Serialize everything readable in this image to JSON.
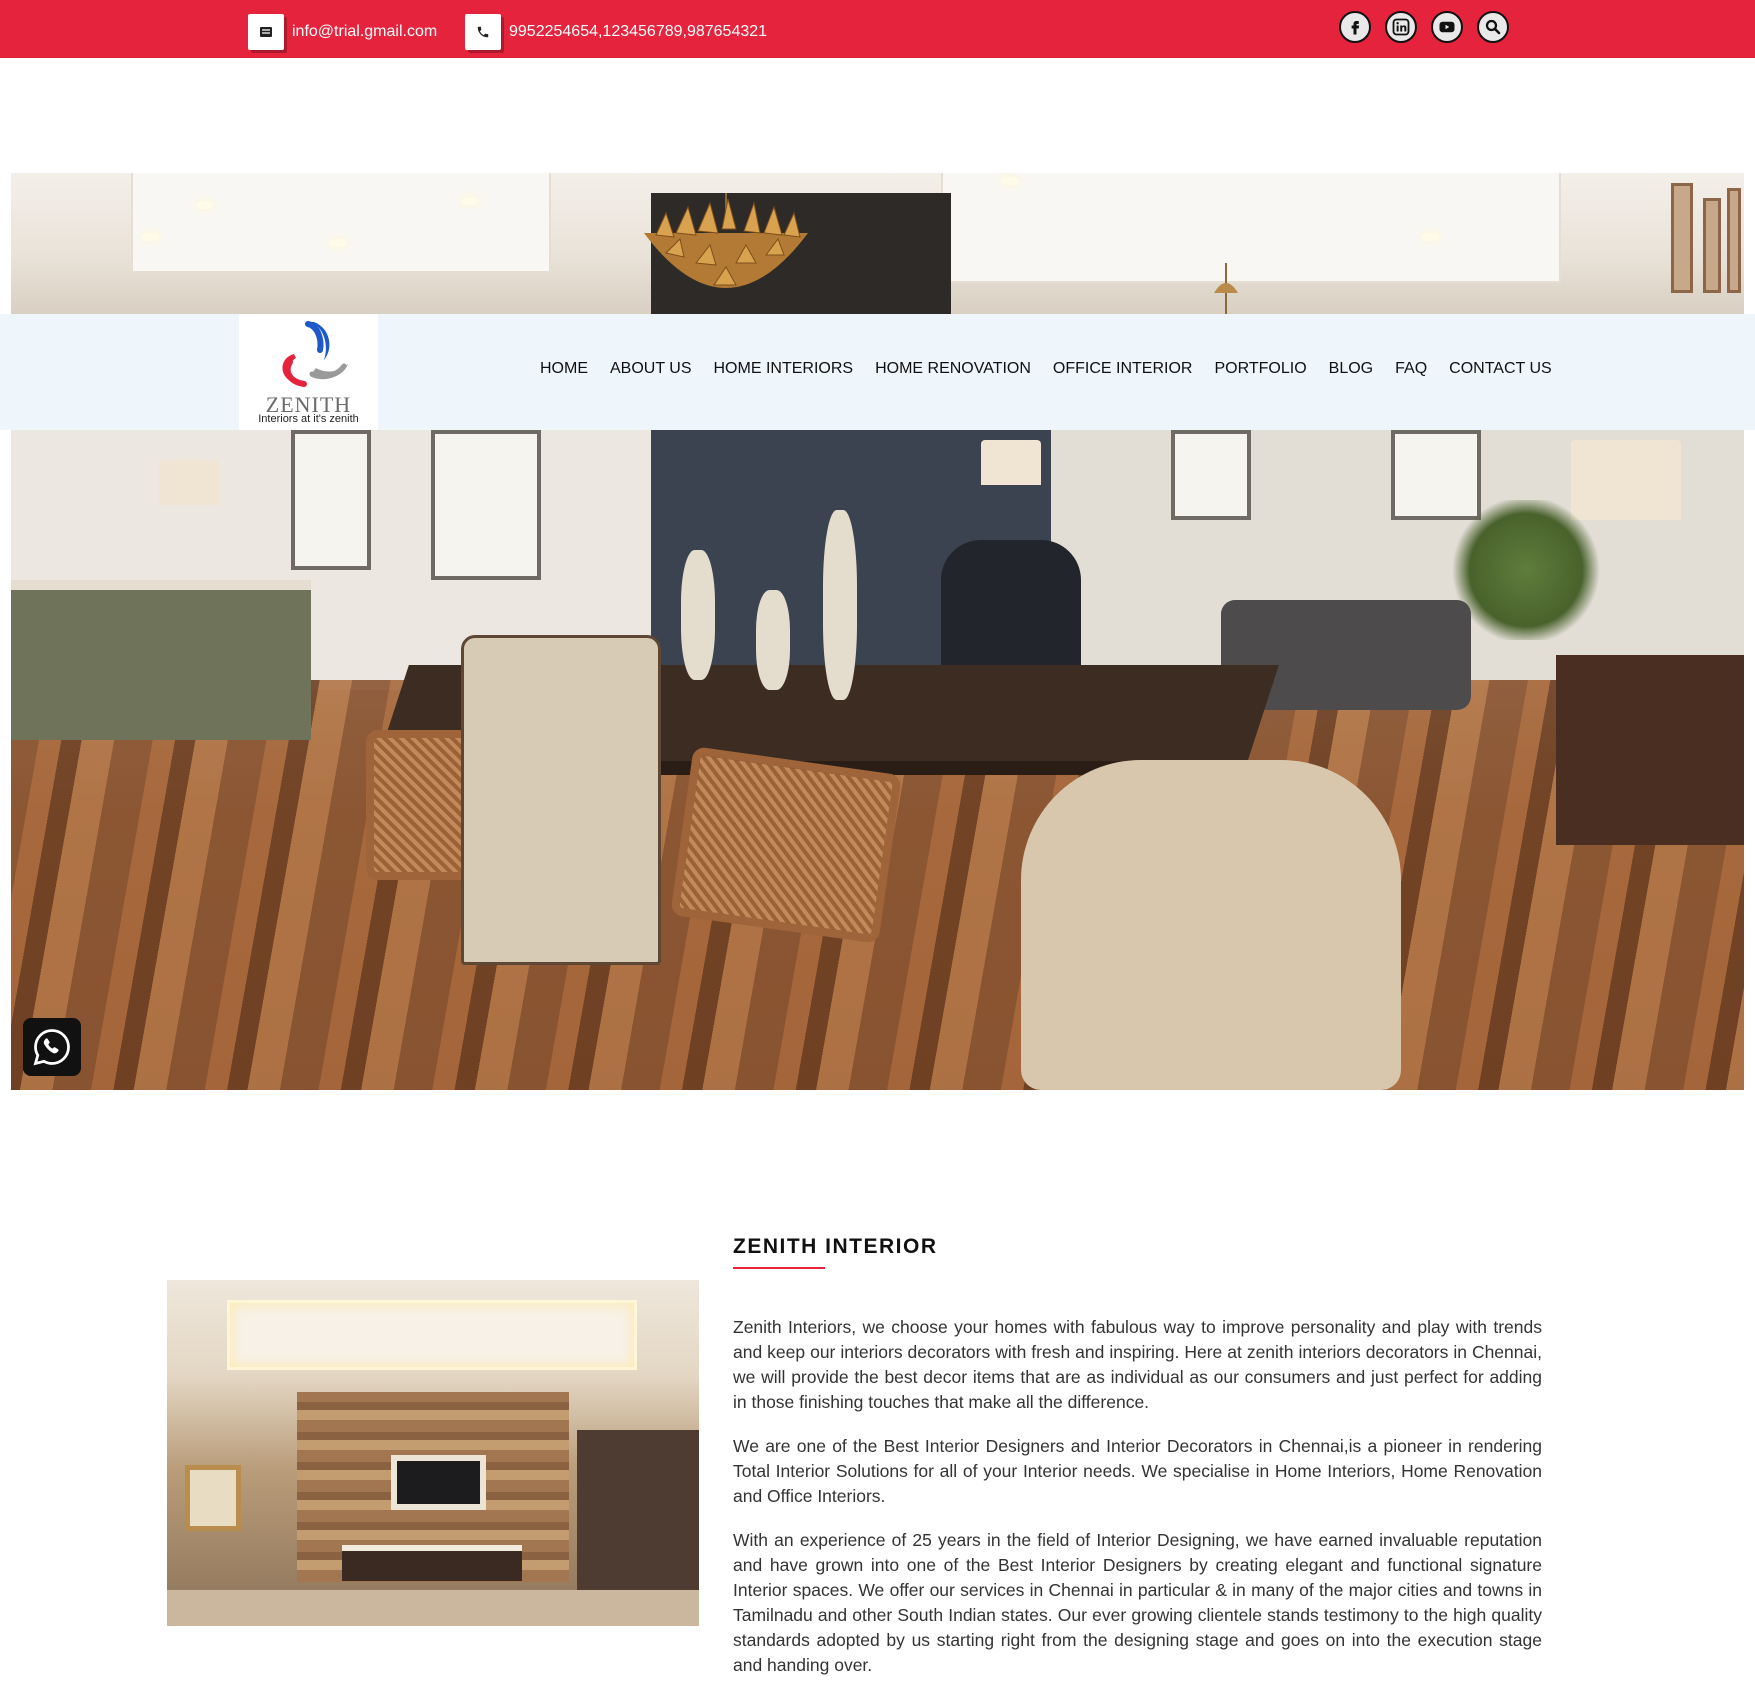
{
  "topbar": {
    "email": "info@trial.gmail.com",
    "phone": "9952254654,123456789,987654321",
    "background": "#e5233c",
    "socials": [
      {
        "name": "facebook-icon"
      },
      {
        "name": "linkedin-icon"
      },
      {
        "name": "youtube-icon"
      },
      {
        "name": "search-icon"
      }
    ]
  },
  "logo": {
    "name": "ZENITH",
    "tagline": "Interiors at it's zenith"
  },
  "nav": {
    "items": [
      {
        "label": "HOME"
      },
      {
        "label": "ABOUT US"
      },
      {
        "label": "HOME INTERIORS"
      },
      {
        "label": "HOME RENOVATION"
      },
      {
        "label": "OFFICE INTERIOR"
      },
      {
        "label": "PORTFOLIO"
      },
      {
        "label": "BLOG"
      },
      {
        "label": "FAQ"
      },
      {
        "label": "CONTACT US"
      }
    ]
  },
  "floating": {
    "icon": "whatsapp-icon"
  },
  "about": {
    "title": "ZENITH INTERIOR",
    "accent": "#e5233c",
    "paragraphs": [
      "Zenith Interiors, we choose your homes with fabulous way to improve personality and play with trends and keep our interiors decorators with fresh and inspiring. Here at zenith interiors decorators in Chennai, we will provide the best decor items that are as individual as our consumers and just perfect for adding in those finishing touches that make all the difference.",
      "We are one of the Best Interior Designers and Interior Decorators in Chennai,is a pioneer in rendering Total Interior Solutions for all of your Interior needs. We specialise in Home Interiors, Home Renovation and Office Interiors.",
      "With an experience of 25 years in the field of Interior Designing, we have earned invaluable reputation and have grown into one of the Best Interior Designers by creating elegant and functional signature Interior spaces. We offer our services in Chennai in particular & in many of the major cities and towns in Tamilnadu and other South Indian states. Our ever growing clientele stands testimony to the high quality standards adopted by us starting right from the designing stage and goes on into the execution stage and handing over."
    ]
  }
}
